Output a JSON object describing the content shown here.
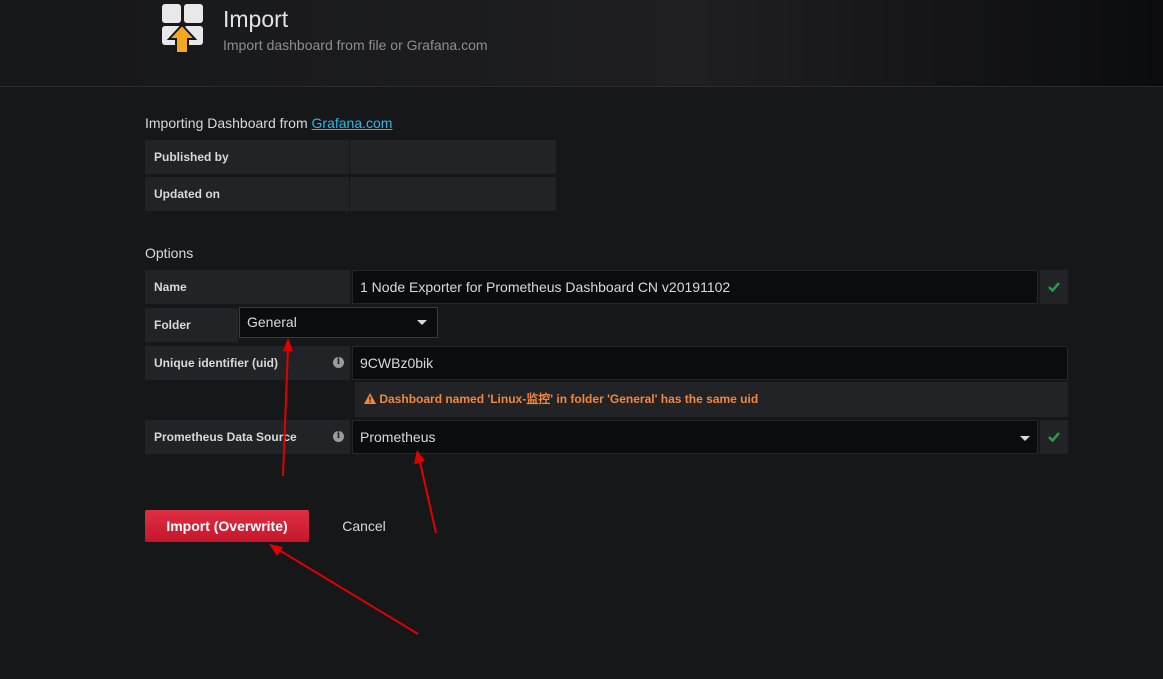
{
  "header": {
    "title": "Import",
    "subtitle": "Import dashboard from file or Grafana.com"
  },
  "source": {
    "prefix": "Importing Dashboard from ",
    "link": "Grafana.com",
    "rows": [
      {
        "label": "Published by",
        "value": ""
      },
      {
        "label": "Updated on",
        "value": ""
      }
    ]
  },
  "options": {
    "title": "Options",
    "name": {
      "label": "Name",
      "value": "1  Node Exporter for Prometheus Dashboard CN v20191102"
    },
    "folder": {
      "label": "Folder",
      "value": "General"
    },
    "uid": {
      "label": "Unique identifier (uid)",
      "value": "9CWBz0bik"
    },
    "warning": "Dashboard named 'Linux-监控' in folder 'General' has the same uid",
    "datasource": {
      "label": "Prometheus Data Source",
      "value": "Prometheus"
    }
  },
  "buttons": {
    "import": "Import (Overwrite)",
    "cancel": "Cancel"
  },
  "colors": {
    "background": "#161719",
    "import_button": "#e02f44",
    "link": "#33b5e5",
    "warning": "#f2863b",
    "success_check": "#299c46",
    "annotation_arrow": "#e00000"
  }
}
